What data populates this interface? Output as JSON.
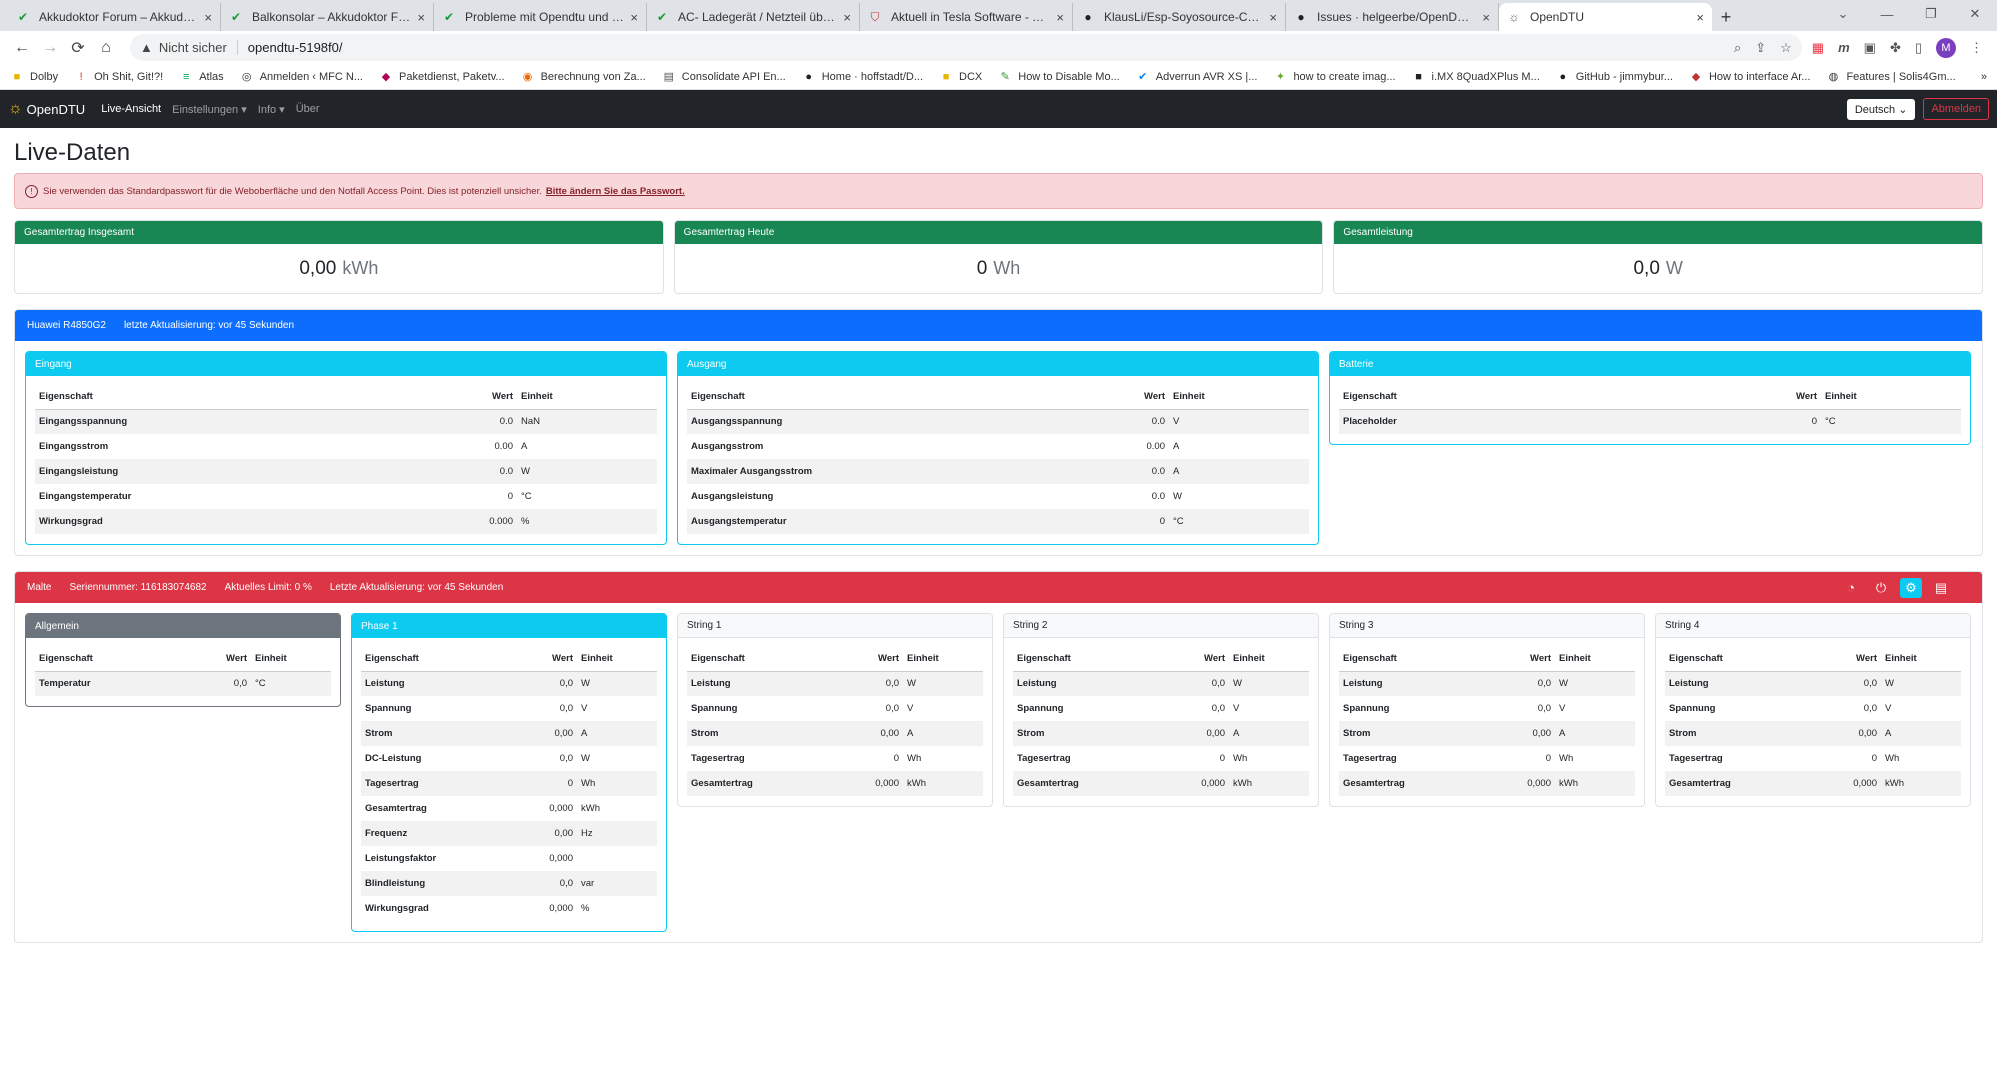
{
  "browser": {
    "tabs": [
      {
        "title": "Akkudoktor Forum – Akkudoktor",
        "icon": "✔"
      },
      {
        "title": "Balkonsolar – Akkudoktor Forum",
        "icon": "✔"
      },
      {
        "title": "Probleme mit Opendtu und Hoy...",
        "icon": "✔"
      },
      {
        "title": "AC- Ladegerät / Netzteil über ESP",
        "icon": "✔"
      },
      {
        "title": "Aktuell in Tesla Software - TFF Fo...",
        "icon": "⛉"
      },
      {
        "title": "KlausLi/Esp-Soyosource-Controlle",
        "icon": "●"
      },
      {
        "title": "Issues · helgeerbe/OpenDTU-On...",
        "icon": "●"
      },
      {
        "title": "OpenDTU",
        "icon": "☼"
      }
    ],
    "address": {
      "security": "Nicht sicher",
      "url": "opendtu-5198f0/"
    },
    "profile_initial": "M",
    "bookmarks": [
      {
        "label": "Dolby",
        "icon": "■"
      },
      {
        "label": "Oh Shit, Git!?!",
        "icon": "!"
      },
      {
        "label": "Atlas",
        "icon": "≡"
      },
      {
        "label": "Anmelden ‹ MFC N...",
        "icon": "◎"
      },
      {
        "label": "Paketdienst, Paketv...",
        "icon": "◆"
      },
      {
        "label": "Berechnung von Za...",
        "icon": "◉"
      },
      {
        "label": "Consolidate API En...",
        "icon": "▤"
      },
      {
        "label": "Home · hoffstadt/D...",
        "icon": "●"
      },
      {
        "label": "DCX",
        "icon": "■"
      },
      {
        "label": "How to Disable Mo...",
        "icon": "✎"
      },
      {
        "label": "Adverrun AVR XS |...",
        "icon": "✔"
      },
      {
        "label": "how to create imag...",
        "icon": "✦"
      },
      {
        "label": "i.MX 8QuadXPlus M...",
        "icon": "■"
      },
      {
        "label": "GitHub - jimmybur...",
        "icon": "●"
      },
      {
        "label": "How to interface Ar...",
        "icon": "◆"
      },
      {
        "label": "Features | Solis4Gm...",
        "icon": "◍"
      }
    ]
  },
  "nav": {
    "brand": "OpenDTU",
    "items": [
      "Live-Ansicht",
      "Einstellungen ▾",
      "Info ▾",
      "Über"
    ],
    "language": "Deutsch",
    "logout": "Abmelden"
  },
  "page_title": "Live-Daten",
  "alert": {
    "text": "Sie verwenden das Standardpasswort für die Weboberfläche und den Notfall Access Point. Dies ist potenziell unsicher.",
    "link": "Bitte ändern Sie das Passwort."
  },
  "totals": [
    {
      "label": "Gesamtertrag Insgesamt",
      "value": "0,00",
      "unit": "kWh"
    },
    {
      "label": "Gesamtertrag Heute",
      "value": "0",
      "unit": "Wh"
    },
    {
      "label": "Gesamtleistung",
      "value": "0,0",
      "unit": "W"
    }
  ],
  "table_headers": {
    "prop": "Eigenschaft",
    "val": "Wert",
    "unit": "Einheit"
  },
  "charger": {
    "name": "Huawei R4850G2",
    "update": "letzte Aktualisierung: vor 45 Sekunden",
    "color": "#0d6efd",
    "cards": [
      {
        "title": "Eingang",
        "rows": [
          [
            "Eingangsspannung",
            "0.0",
            "NaN"
          ],
          [
            "Eingangsstrom",
            "0.00",
            "A"
          ],
          [
            "Eingangsleistung",
            "0.0",
            "W"
          ],
          [
            "Eingangstemperatur",
            "0",
            "°C"
          ],
          [
            "Wirkungsgrad",
            "0.000",
            "%"
          ]
        ]
      },
      {
        "title": "Ausgang",
        "rows": [
          [
            "Ausgangsspannung",
            "0.0",
            "V"
          ],
          [
            "Ausgangsstrom",
            "0.00",
            "A"
          ],
          [
            "Maximaler Ausgangsstrom",
            "0.0",
            "A"
          ],
          [
            "Ausgangsleistung",
            "0.0",
            "W"
          ],
          [
            "Ausgangstemperatur",
            "0",
            "°C"
          ]
        ]
      },
      {
        "title": "Batterie",
        "rows": [
          [
            "Placeholder",
            "0",
            "°C"
          ]
        ]
      }
    ]
  },
  "inverter": {
    "name": "Malte",
    "serial": "Seriennummer: 116183074682",
    "limit": "Aktuelles Limit: 0 %",
    "update": "Letzte Aktualisierung: vor 45 Sekunden",
    "color": "#dc3545",
    "cards": [
      {
        "title": "Allgemein",
        "style": "grey",
        "rows": [
          [
            "Temperatur",
            "0,0",
            "°C"
          ]
        ]
      },
      {
        "title": "Phase 1",
        "style": "cyan",
        "rows": [
          [
            "Leistung",
            "0,0",
            "W"
          ],
          [
            "Spannung",
            "0,0",
            "V"
          ],
          [
            "Strom",
            "0,00",
            "A"
          ],
          [
            "DC-Leistung",
            "0,0",
            "W"
          ],
          [
            "Tagesertrag",
            "0",
            "Wh"
          ],
          [
            "Gesamtertrag",
            "0,000",
            "kWh"
          ],
          [
            "Frequenz",
            "0,00",
            "Hz"
          ],
          [
            "Leistungsfaktor",
            "0,000",
            ""
          ],
          [
            "Blindleistung",
            "0,0",
            "var"
          ],
          [
            "Wirkungsgrad",
            "0,000",
            "%"
          ]
        ]
      },
      {
        "title": "String 1",
        "style": "light",
        "rows": [
          [
            "Leistung",
            "0,0",
            "W"
          ],
          [
            "Spannung",
            "0,0",
            "V"
          ],
          [
            "Strom",
            "0,00",
            "A"
          ],
          [
            "Tagesertrag",
            "0",
            "Wh"
          ],
          [
            "Gesamtertrag",
            "0,000",
            "kWh"
          ]
        ]
      },
      {
        "title": "String 2",
        "style": "light",
        "rows": [
          [
            "Leistung",
            "0,0",
            "W"
          ],
          [
            "Spannung",
            "0,0",
            "V"
          ],
          [
            "Strom",
            "0,00",
            "A"
          ],
          [
            "Tagesertrag",
            "0",
            "Wh"
          ],
          [
            "Gesamtertrag",
            "0,000",
            "kWh"
          ]
        ]
      },
      {
        "title": "String 3",
        "style": "light",
        "rows": [
          [
            "Leistung",
            "0,0",
            "W"
          ],
          [
            "Spannung",
            "0,0",
            "V"
          ],
          [
            "Strom",
            "0,00",
            "A"
          ],
          [
            "Tagesertrag",
            "0",
            "Wh"
          ],
          [
            "Gesamtertrag",
            "0,000",
            "kWh"
          ]
        ]
      },
      {
        "title": "String 4",
        "style": "light",
        "rows": [
          [
            "Leistung",
            "0,0",
            "W"
          ],
          [
            "Spannung",
            "0,0",
            "V"
          ],
          [
            "Strom",
            "0,00",
            "A"
          ],
          [
            "Tagesertrag",
            "0",
            "Wh"
          ],
          [
            "Gesamtertrag",
            "0,000",
            "kWh"
          ]
        ]
      }
    ]
  }
}
